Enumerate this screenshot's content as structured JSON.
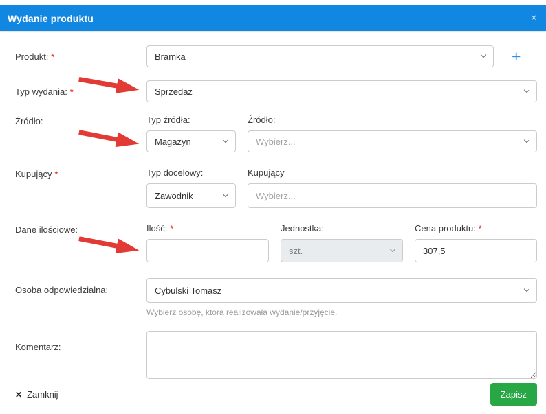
{
  "modal": {
    "title": "Wydanie produktu"
  },
  "icons": {
    "close": "×",
    "footer_close": "✕",
    "plus": "+"
  },
  "ui": {
    "required_marker": "*"
  },
  "fields": {
    "produkt": {
      "label": "Produkt:",
      "value": "Bramka"
    },
    "typ_wydania": {
      "label": "Typ wydania:",
      "value": "Sprzedaż"
    },
    "zrodlo": {
      "label": "Źródło:",
      "typ_zrodla_label": "Typ źródła:",
      "typ_zrodla_value": "Magazyn",
      "zrodlo_label": "Źródło:",
      "zrodlo_placeholder": "Wybierz..."
    },
    "kupujacy": {
      "label": "Kupujący",
      "typ_docelowy_label": "Typ docelowy:",
      "typ_docelowy_value": "Zawodnik",
      "kupujacy_label": "Kupujący",
      "kupujacy_placeholder": "Wybierz..."
    },
    "dane_ilosciowe": {
      "label": "Dane ilościowe:",
      "ilosc_label": "Ilość:",
      "ilosc_value": "",
      "jednostka_label": "Jednostka:",
      "jednostka_value": "szt.",
      "cena_label": "Cena produktu:",
      "cena_value": "307,5"
    },
    "osoba": {
      "label": "Osoba odpowiedzialna:",
      "value": "Cybulski Tomasz",
      "helper": "Wybierz osobę, która realizowała wydanie/przyjęcie."
    },
    "komentarz": {
      "label": "Komentarz:",
      "value": ""
    }
  },
  "footer": {
    "close_label": "Zamknij",
    "save_label": "Zapisz"
  },
  "colors": {
    "header_blue": "#1287e1",
    "accent_blue": "#2b8fe8",
    "save_green": "#28a745",
    "arrow_red": "#e23b36",
    "asterisk_red": "#e8413c",
    "disabled_bg": "#e9ecef"
  }
}
